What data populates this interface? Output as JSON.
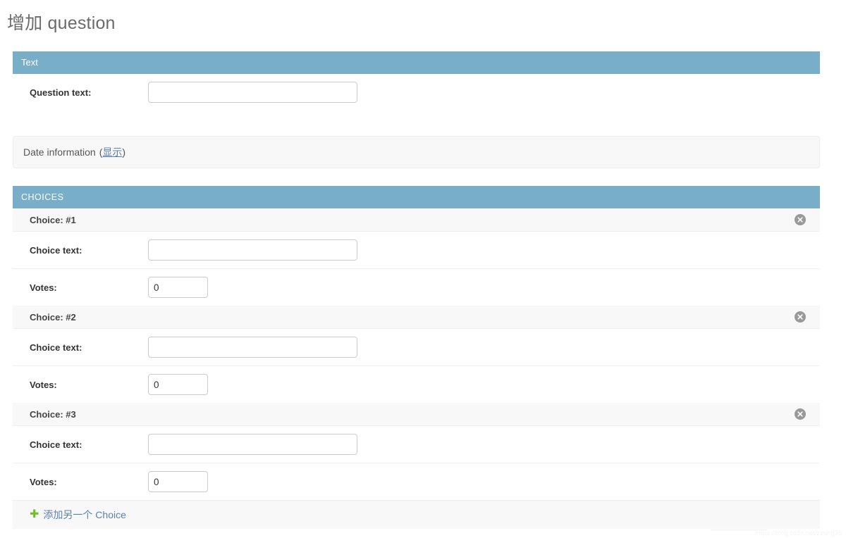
{
  "page": {
    "title": "增加 question",
    "watermark": "https://blog.csdn.net/zzung35"
  },
  "text_module": {
    "header": "Text",
    "rows": [
      {
        "label": "Question text:",
        "value": "",
        "placeholder": ""
      }
    ]
  },
  "date_fieldset": {
    "label": "Date information",
    "open_paren": "(",
    "toggle_link": "显示",
    "close_paren": ")"
  },
  "choices_module": {
    "header": "CHOICES",
    "delete_icon": "remove-circle-icon",
    "inlines": [
      {
        "title": "Choice: #1",
        "rows": [
          {
            "label": "Choice text:",
            "value": "",
            "type": "wide"
          },
          {
            "label": "Votes:",
            "value": "0",
            "type": "small"
          }
        ]
      },
      {
        "title": "Choice: #2",
        "rows": [
          {
            "label": "Choice text:",
            "value": "",
            "type": "wide"
          },
          {
            "label": "Votes:",
            "value": "0",
            "type": "small"
          }
        ]
      },
      {
        "title": "Choice: #3",
        "rows": [
          {
            "label": "Choice text:",
            "value": "",
            "type": "wide"
          },
          {
            "label": "Votes:",
            "value": "0",
            "type": "small"
          }
        ]
      }
    ],
    "add_row": {
      "icon": "plus-icon",
      "label": "添加另一个 Choice"
    }
  },
  "colors": {
    "module_header_bg": "#79aec8",
    "link": "#5b80b2",
    "add_icon": "#70bf2b",
    "row_header_bg": "#f8f8f8",
    "border": "#eeeeee",
    "title_text": "#6b6b6b"
  }
}
